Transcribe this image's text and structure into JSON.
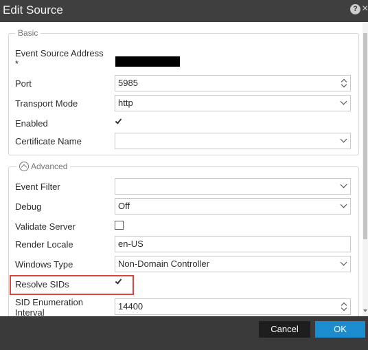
{
  "dialog": {
    "title": "Edit Source"
  },
  "basic": {
    "legend": "Basic",
    "event_source_address": {
      "label": "Event Source Address",
      "label_suffix": "*"
    },
    "port": {
      "label": "Port",
      "value": "5985"
    },
    "transport_mode": {
      "label": "Transport Mode",
      "value": "http"
    },
    "enabled": {
      "label": "Enabled",
      "checked": true
    },
    "certificate_name": {
      "label": "Certificate Name",
      "value": ""
    }
  },
  "advanced": {
    "legend": "Advanced",
    "event_filter": {
      "label": "Event Filter",
      "value": ""
    },
    "debug": {
      "label": "Debug",
      "value": "Off"
    },
    "validate_server": {
      "label": "Validate Server",
      "checked": false
    },
    "render_locale": {
      "label": "Render Locale",
      "value": "en-US"
    },
    "windows_type": {
      "label": "Windows Type",
      "value": "Non-Domain Controller"
    },
    "resolve_sids": {
      "label": "Resolve SIDs",
      "checked": true
    },
    "sid_enumeration_interval": {
      "label_line1": "SID Enumeration",
      "label_line2": "Interval",
      "value": "14400"
    }
  },
  "footer": {
    "cancel_label": "Cancel",
    "ok_label": "OK"
  },
  "icons": {
    "help": "?",
    "close": "×"
  },
  "colors": {
    "titlebar": "#3f3f3f",
    "footer": "#3a3a3a",
    "ok_button": "#1c8ccf",
    "highlight": "#e0433e"
  }
}
